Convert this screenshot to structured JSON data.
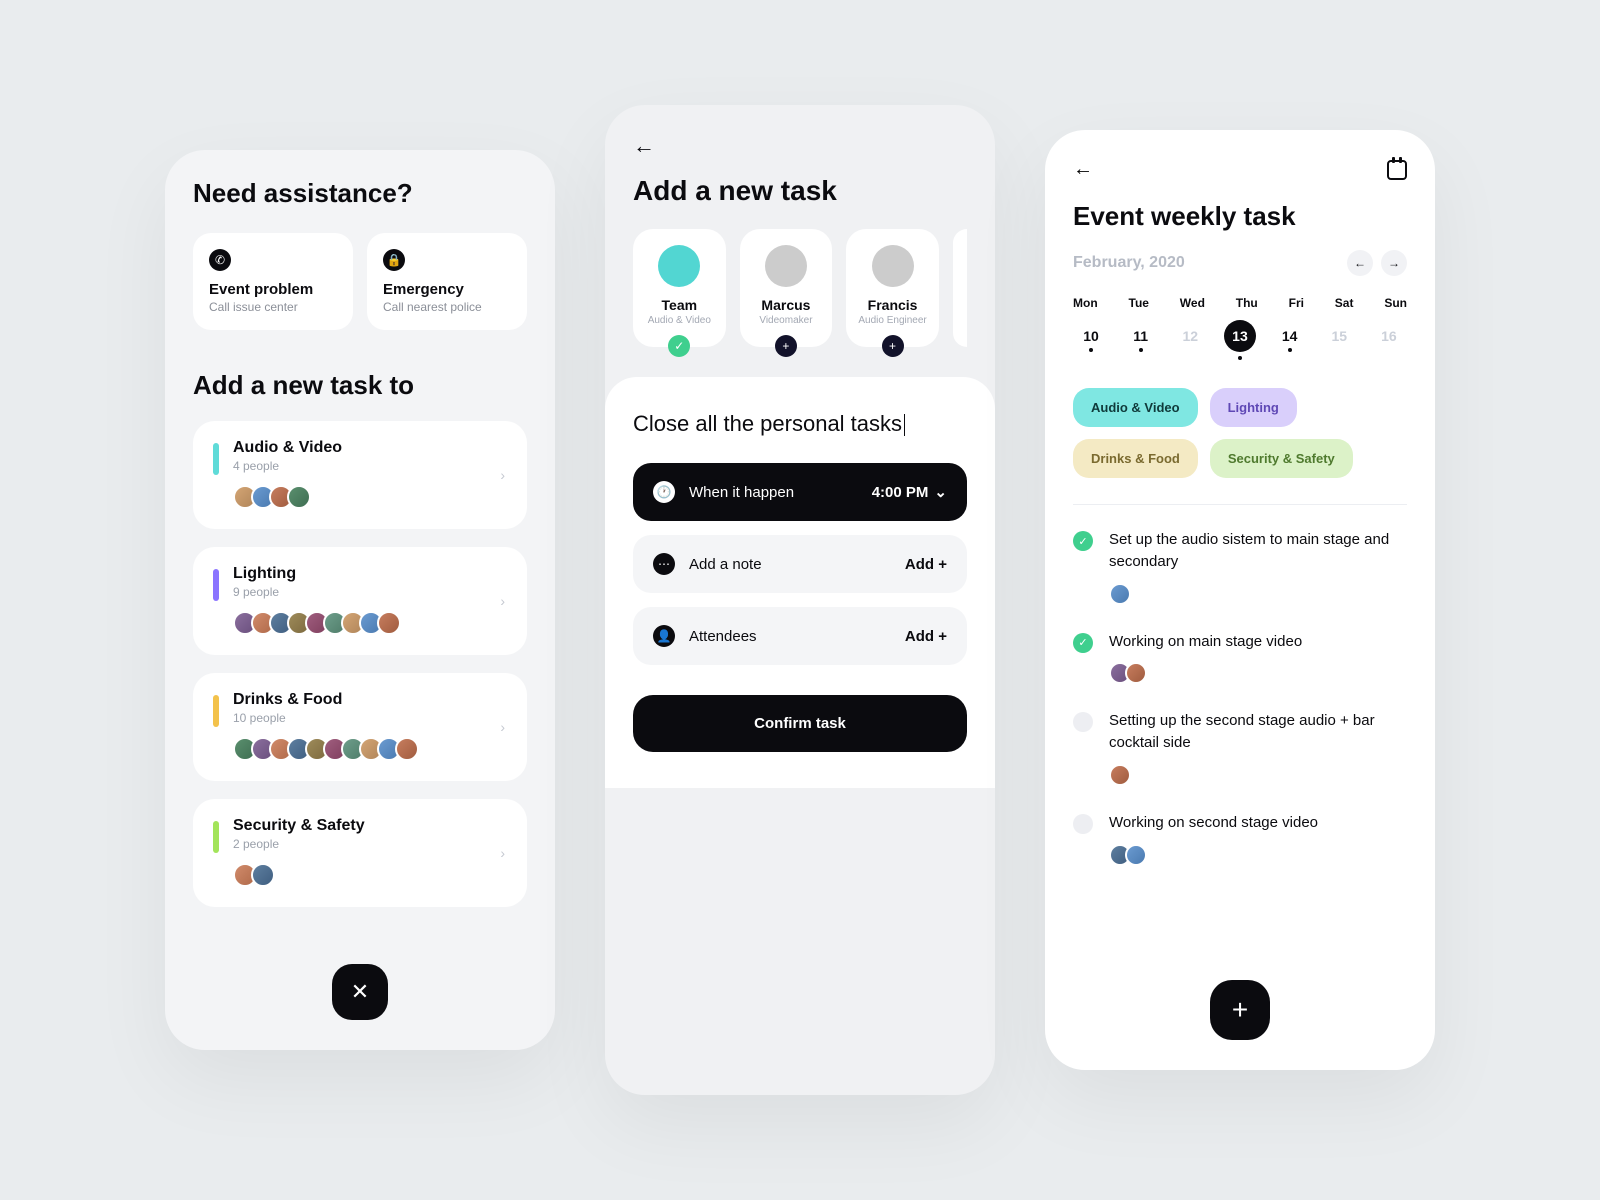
{
  "screen1": {
    "title": "Need assistance?",
    "help": [
      {
        "title": "Event problem",
        "sub": "Call issue center",
        "icon": "phone-icon"
      },
      {
        "title": "Emergency",
        "sub": "Call nearest police",
        "icon": "lock-icon"
      }
    ],
    "add_title": "Add a new task to",
    "categories": [
      {
        "name": "Audio & Video",
        "people": "4 people",
        "color": "teal",
        "avatars": 4
      },
      {
        "name": "Lighting",
        "people": "9 people",
        "color": "purple",
        "avatars": 9
      },
      {
        "name": "Drinks & Food",
        "people": "10 people",
        "color": "amber",
        "avatars": 10
      },
      {
        "name": "Security & Safety",
        "people": "2 people",
        "color": "lime",
        "avatars": 2
      }
    ]
  },
  "screen2": {
    "title": "Add a new task",
    "assignees": [
      {
        "name": "Team",
        "role": "Audio & Video",
        "selected": true
      },
      {
        "name": "Marcus",
        "role": "Videomaker",
        "selected": false
      },
      {
        "name": "Francis",
        "role": "Audio Engineer",
        "selected": false
      }
    ],
    "task_text": "Close all the personal tasks",
    "when_label": "When it happen",
    "when_value": "4:00 PM",
    "note_label": "Add a note",
    "note_action": "Add +",
    "attendees_label": "Attendees",
    "attendees_action": "Add +",
    "confirm": "Confirm task"
  },
  "screen3": {
    "title": "Event weekly task",
    "month": "February, 2020",
    "weekdays": [
      "Mon",
      "Tue",
      "Wed",
      "Thu",
      "Fri",
      "Sat",
      "Sun"
    ],
    "days": [
      {
        "n": "10",
        "muted": false,
        "sel": false,
        "dot": true
      },
      {
        "n": "11",
        "muted": false,
        "sel": false,
        "dot": true
      },
      {
        "n": "12",
        "muted": true,
        "sel": false,
        "dot": false
      },
      {
        "n": "13",
        "muted": false,
        "sel": true,
        "dot": true
      },
      {
        "n": "14",
        "muted": false,
        "sel": false,
        "dot": true
      },
      {
        "n": "15",
        "muted": true,
        "sel": false,
        "dot": false
      },
      {
        "n": "16",
        "muted": true,
        "sel": false,
        "dot": false
      }
    ],
    "chips": [
      {
        "label": "Audio & Video",
        "cls": "c-teal"
      },
      {
        "label": "Lighting",
        "cls": "c-lav"
      },
      {
        "label": "Drinks & Food",
        "cls": "c-cream"
      },
      {
        "label": "Security & Safety",
        "cls": "c-mint"
      }
    ],
    "tasks": [
      {
        "done": true,
        "text": "Set up the audio sistem to main stage and secondary",
        "av": 1
      },
      {
        "done": true,
        "text": "Working on main stage video",
        "av": 2
      },
      {
        "done": false,
        "text": "Setting up the second stage audio + bar cocktail side",
        "av": 1
      },
      {
        "done": false,
        "text": "Working on second stage video",
        "av": 2
      }
    ]
  }
}
